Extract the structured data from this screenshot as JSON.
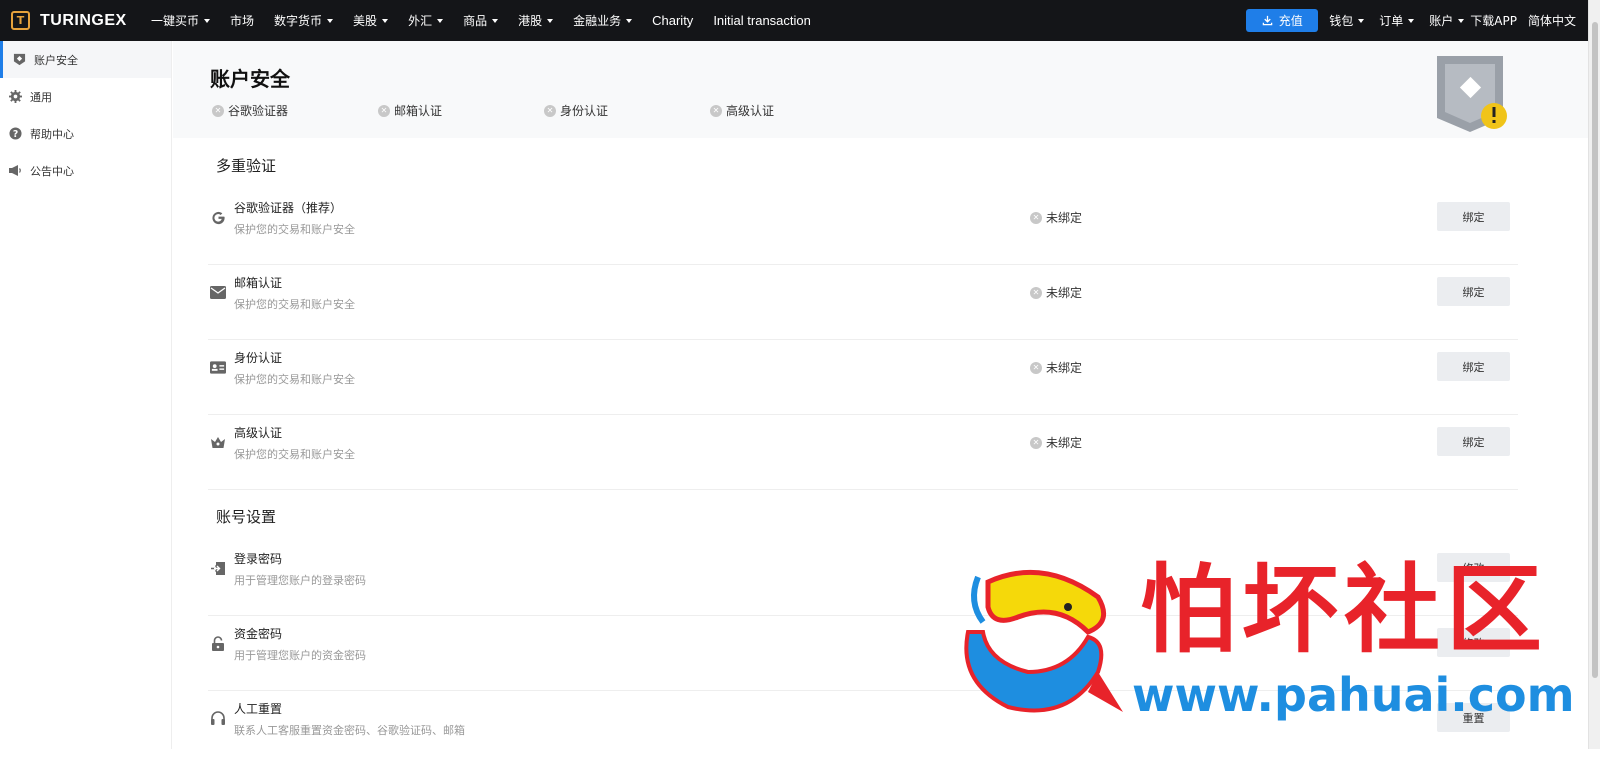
{
  "brand": {
    "logo_glyph": "T",
    "name": "TURINGEX"
  },
  "nav": {
    "items": [
      {
        "label": "一键买币",
        "dropdown": true
      },
      {
        "label": "市场",
        "dropdown": false
      },
      {
        "label": "数字货币",
        "dropdown": true
      },
      {
        "label": "美股",
        "dropdown": true
      },
      {
        "label": "外汇",
        "dropdown": true
      },
      {
        "label": "商品",
        "dropdown": true
      },
      {
        "label": "港股",
        "dropdown": true
      },
      {
        "label": "金融业务",
        "dropdown": true
      },
      {
        "label": "Charity",
        "dropdown": false
      },
      {
        "label": "Initial transaction",
        "dropdown": false
      }
    ],
    "recharge_label": "充值",
    "wallet_label": "钱包",
    "orders_label": "订单",
    "account_label": "账户",
    "download_label": "下载APP",
    "language_label": "简体中文"
  },
  "sidebar": {
    "items": [
      {
        "label": "账户安全",
        "icon": "shield-icon",
        "active": true
      },
      {
        "label": "通用",
        "icon": "gear-icon",
        "active": false
      },
      {
        "label": "帮助中心",
        "icon": "help-icon",
        "active": false
      },
      {
        "label": "公告中心",
        "icon": "megaphone-icon",
        "active": false
      }
    ]
  },
  "header": {
    "title": "账户安全",
    "badges": [
      "谷歌验证器",
      "邮箱认证",
      "身份认证",
      "高级认证"
    ]
  },
  "mfa": {
    "section_title": "多重验证",
    "rows": [
      {
        "title": "谷歌验证器（推荐）",
        "desc": "保护您的交易和账户安全",
        "status": "未绑定",
        "button": "绑定",
        "icon": "google-icon"
      },
      {
        "title": "邮箱认证",
        "desc": "保护您的交易和账户安全",
        "status": "未绑定",
        "button": "绑定",
        "icon": "mail-icon"
      },
      {
        "title": "身份认证",
        "desc": "保护您的交易和账户安全",
        "status": "未绑定",
        "button": "绑定",
        "icon": "id-card-icon"
      },
      {
        "title": "高级认证",
        "desc": "保护您的交易和账户安全",
        "status": "未绑定",
        "button": "绑定",
        "icon": "crown-icon"
      }
    ]
  },
  "account_settings": {
    "section_title": "账号设置",
    "rows": [
      {
        "title": "登录密码",
        "desc": "用于管理您账户的登录密码",
        "button": "修改",
        "icon": "login-icon"
      },
      {
        "title": "资金密码",
        "desc": "用于管理您账户的资金密码",
        "button": "修改",
        "icon": "lock-icon"
      },
      {
        "title": "人工重置",
        "desc": "联系人工客服重置资金密码、谷歌验证码、邮箱",
        "button": "重置",
        "icon": "headset-icon"
      }
    ]
  },
  "watermark": {
    "text": "怕坏社区",
    "url": "www.pahuai.com"
  },
  "colors": {
    "topbar": "#141518",
    "accent": "#1f7ee8",
    "warning": "#f0c419",
    "watermark_red": "#e8232a",
    "watermark_blue": "#1e8ee0"
  }
}
